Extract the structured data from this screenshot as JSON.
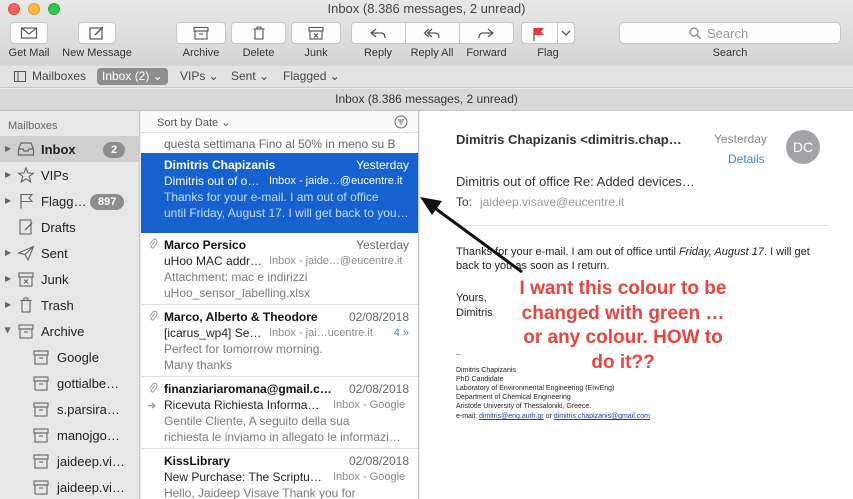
{
  "window": {
    "title": "Inbox (8.386 messages, 2 unread)"
  },
  "toolbar": {
    "get_mail": "Get Mail",
    "new_message": "New Message",
    "archive": "Archive",
    "delete": "Delete",
    "junk": "Junk",
    "reply": "Reply",
    "reply_all": "Reply All",
    "forward": "Forward",
    "flag": "Flag",
    "search_placeholder": "Search",
    "search_label": "Search"
  },
  "favorites": [
    {
      "label": "Mailboxes"
    },
    {
      "label": "Inbox (2) ⌄"
    },
    {
      "label": "VIPs ⌄"
    },
    {
      "label": "Sent ⌄"
    },
    {
      "label": "Flagged ⌄"
    }
  ],
  "status_text": "Inbox (8.386 messages, 2 unread)",
  "sidebar": {
    "heading": "Mailboxes",
    "items": [
      {
        "label": "Inbox",
        "badge": "2"
      },
      {
        "label": "VIPs"
      },
      {
        "label": "Flagg…",
        "badge": "897"
      },
      {
        "label": "Drafts"
      },
      {
        "label": "Sent"
      },
      {
        "label": "Junk"
      },
      {
        "label": "Trash"
      },
      {
        "label": "Archive"
      },
      {
        "label": "Google"
      },
      {
        "label": "gottialbe…"
      },
      {
        "label": "s.parsira…"
      },
      {
        "label": "manojgo…"
      },
      {
        "label": "jaideep.vi…"
      },
      {
        "label": "jaideep.vi…"
      }
    ]
  },
  "message_list": {
    "sort_label": "Sort by Date ⌄",
    "partial_line": "questa settimana Fino al 50% in meno su B",
    "messages": [
      {
        "from": "Dimitris Chapizanis",
        "date": "Yesterday",
        "subject": "Dimitris out of o…",
        "mailbox": "Inbox - jaide…@eucentre.it",
        "line1": "Thanks for your e-mail. I am out of office",
        "line2": "until Friday, August 17. I will get back to you…"
      },
      {
        "from": "Marco Persico",
        "date": "Yesterday",
        "subject": "uHoo MAC addr…",
        "mailbox": "Inbox - jaide…@eucentre.it",
        "line1": "Attachment: mac e indirizzi",
        "line2": "uHoo_sensor_labelling.xlsx"
      },
      {
        "from": "Marco, Alberto & Theodore",
        "date": "02/08/2018",
        "subject": "[icarus_wp4] Se…",
        "mailbox": "Inbox - jai…ucentre.it",
        "thread": "4 »",
        "line1": "Perfect for tomorrow morning.",
        "line2": "Many thanks"
      },
      {
        "from": "finanziariaromana@gmail.c…",
        "date": "02/08/2018",
        "subject": "Ricevuta Richiesta Informa…",
        "mailbox": "Inbox - Google",
        "line1": "Gentile Cliente, A seguito della sua",
        "line2": "richiesta le inviamo in allegato le informazi…"
      },
      {
        "from": "KissLibrary",
        "date": "02/08/2018",
        "subject": "New Purchase: The Scriptu…",
        "mailbox": "Inbox - Google",
        "line1": "Hello, Jaideep Visave Thank you for",
        "line2": ""
      }
    ]
  },
  "preview": {
    "from": "Dimitris Chapizanis <dimitris.chap…",
    "date": "Yesterday",
    "details": "Details",
    "avatar": "DC",
    "subject": "Dimitris out of office Re: Added devices…",
    "to_label": "To:",
    "to": "jaideep.visave@eucentre.it",
    "body_pre": "Thanks for your e-mail. I am out of office until ",
    "body_em": "Friday, August 17",
    "body_post": ". I will get back to you as soon as I return.",
    "sign1": "Yours,",
    "sign2": "Dimitris",
    "signature": [
      "--",
      "Dimitris Chapizanis",
      "PhD Candidate",
      "Laboratory of Environmental Engineering (EnvEng)",
      "Department of Chemical Engineering",
      "Aristotle University of Thessaloniki, Greece."
    ],
    "email_label": "e-mail: ",
    "email1": "dimitris@eng.auth.gr",
    "email_or": " or ",
    "email2": "dimitris.chapizanis@gmail.com"
  },
  "annotation": {
    "text": "I want this colour to be changed with green … or any colour. HOW to do it??",
    "color": "#e8453c"
  },
  "colors": {
    "selection": "#1561d0",
    "link": "#3a87e0"
  }
}
